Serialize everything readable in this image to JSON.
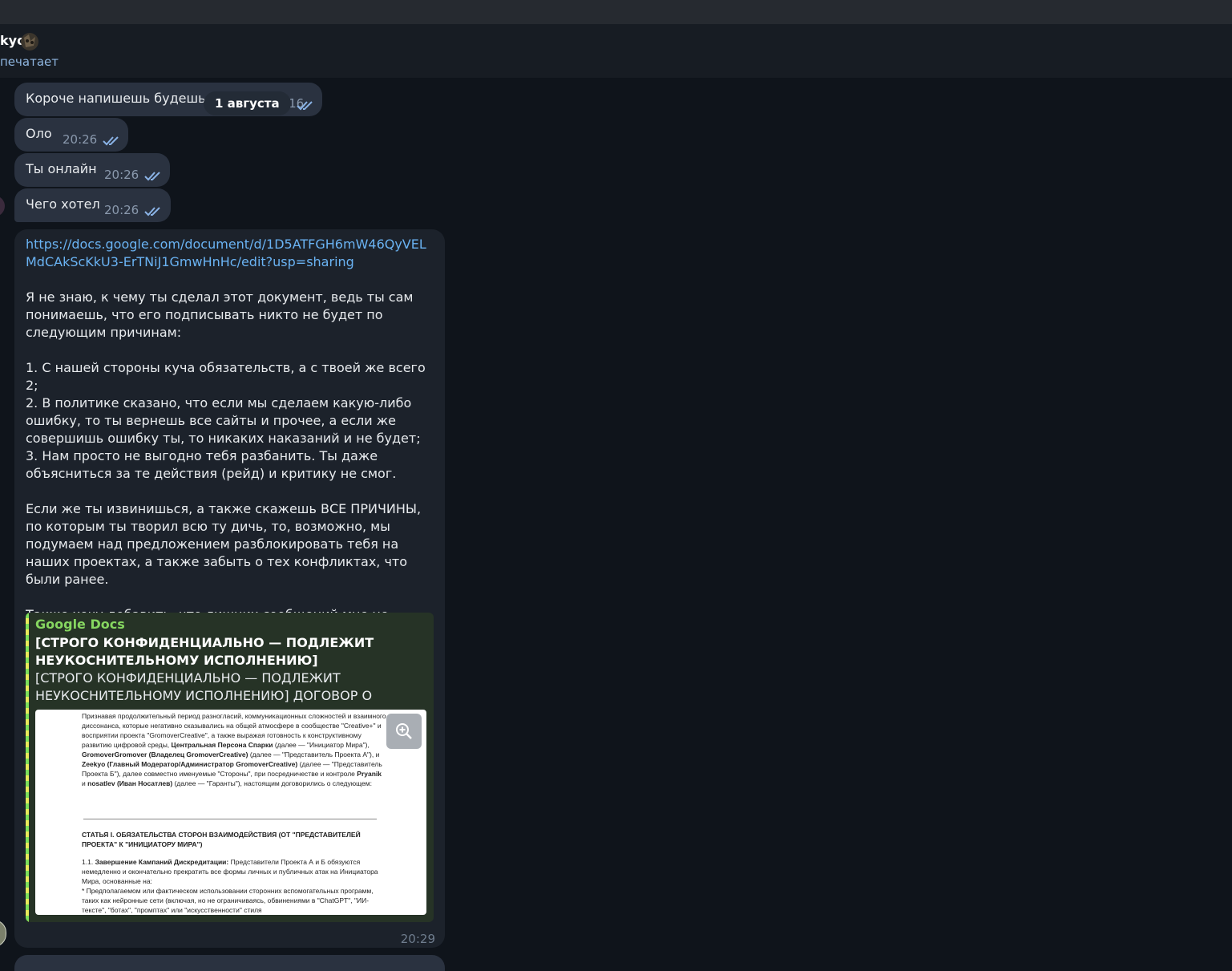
{
  "header": {
    "contact_name": "kyo",
    "status": "печатает"
  },
  "date_divider": "1 августа",
  "messages": [
    {
      "text": "Короче напишешь будешь",
      "time": "20:16"
    },
    {
      "text": "Оло",
      "time": "20:26"
    },
    {
      "text": "Ты онлайн",
      "time": "20:26"
    },
    {
      "text": "Чего хотел",
      "time": "20:26"
    }
  ],
  "long_message": {
    "url": "https://docs.google.com/document/d/1D5ATFGH6mW46QyVELMdCAkScKkU3-ErTNiJ1GmwHnHc/edit?usp=sharing",
    "paragraphs": [
      "Я не знаю, к чему ты сделал этот документ, ведь ты сам понимаешь, что его подписывать никто не будет по следующим причинам:",
      "1. С нашей стороны куча обязательств, а с твоей же всего 2;\n2. В политике сказано, что если мы сделаем какую-либо ошибку, то ты вернешь все сайты и прочее, а если же совершишь ошибку ты, то никаких наказаний и не будет;\n3. Нам просто не выгодно тебя разбанить. Ты даже объясниться за те действия (рейд) и критику не смог.",
      "Если же ты извинишься, а также скажешь ВСЕ ПРИЧИНЫ, по которым ты творил всю ту дичь, то, возможно, мы подумаем над предложением разблокировать тебя на наших проектах, а также забыть о тех конфликтах, что были ранее.",
      "Также хочу добавить, что лишних сообщений мне не нужно. Либо извинения и объяснения, либо ничего."
    ],
    "time": "20:29",
    "preview": {
      "site_name": "Google Docs",
      "title": "[СТРОГО КОНФИДЕНЦИАЛЬНО — ПОДЛЕЖИТ НЕУКОСНИТЕЛЬНОМУ ИСПОЛНЕНИЮ]",
      "description": "[СТРОГО КОНФИДЕНЦИАЛЬНО — ПОДЛЕЖИТ НЕУКОСНИТЕЛЬНОМУ ИСПОЛНЕНИЮ] ДОГОВОР О НОРМАЛ...",
      "doc_intro": "Признавая продолжительный период разногласий, коммуникационных сложностей и взаимного диссонанса, которые негативно сказывались на общей атмосфере в сообществе \"Creative+\" и восприятии проекта \"GromoverCreative\", а также выражая готовность к конструктивному развитию цифровой среды,",
      "doc_p1_bold": "Центральная Персона Спарки",
      "doc_p1_rest": "(далее — \"Инициатор Мира\"),",
      "doc_p2_bold": "GromoverGromover (Владелец GromoverCreative)",
      "doc_p2_rest": "(далее — \"Представитель Проекта А\"), и",
      "doc_p3_bold": "Zeekyo (Главный Модератор/Администратор GromoverCreative)",
      "doc_p3_rest": "(далее — \"Представитель Проекта Б\"), далее совместно именуемые \"Стороны\", при посредничестве и контроле",
      "doc_p4_bold": "Pryanik",
      "doc_p4_mid": "и",
      "doc_p5_bold": "nosatlev (Иван Носатлев)",
      "doc_p5_rest": "(далее — \"Гаранты\"), настоящим договорились о следующем:",
      "doc_heading": "СТАТЬЯ I. ОБЯЗАТЕЛЬСТВА СТОРОН ВЗАИМОДЕЙСТВИЯ (ОТ \"ПРЕДСТАВИТЕЛЕЙ ПРОЕКТА\" К \"ИНИЦИАТОРУ МИРА\")",
      "doc_clause_num": "1.1.",
      "doc_clause_bold": "Завершение Кампаний Дискредитации:",
      "doc_clause_rest": "Представители Проекта А и Б обязуются немедленно и окончательно прекратить все формы личных и публичных атак на Инициатора Мира, основанные на:",
      "doc_bullet": "* Предполагаемом или фактическом использовании сторонних вспомогательных программ, таких как нейронные сети (включая, но не ограничиваясь, обвинениями в \"ChatGPT\", \"ИИ-тексте\", \"ботах\", \"промптах\" или \"искусственности\" стиля"
    }
  },
  "colors": {
    "background": "#0f141b",
    "bubble": "#2a3240",
    "link": "#6ab3f3",
    "preview_accent": "#86d660",
    "status": "#8fb6e0"
  },
  "icons": [
    "double-check-icon",
    "zoom-in-icon",
    "avatar"
  ]
}
